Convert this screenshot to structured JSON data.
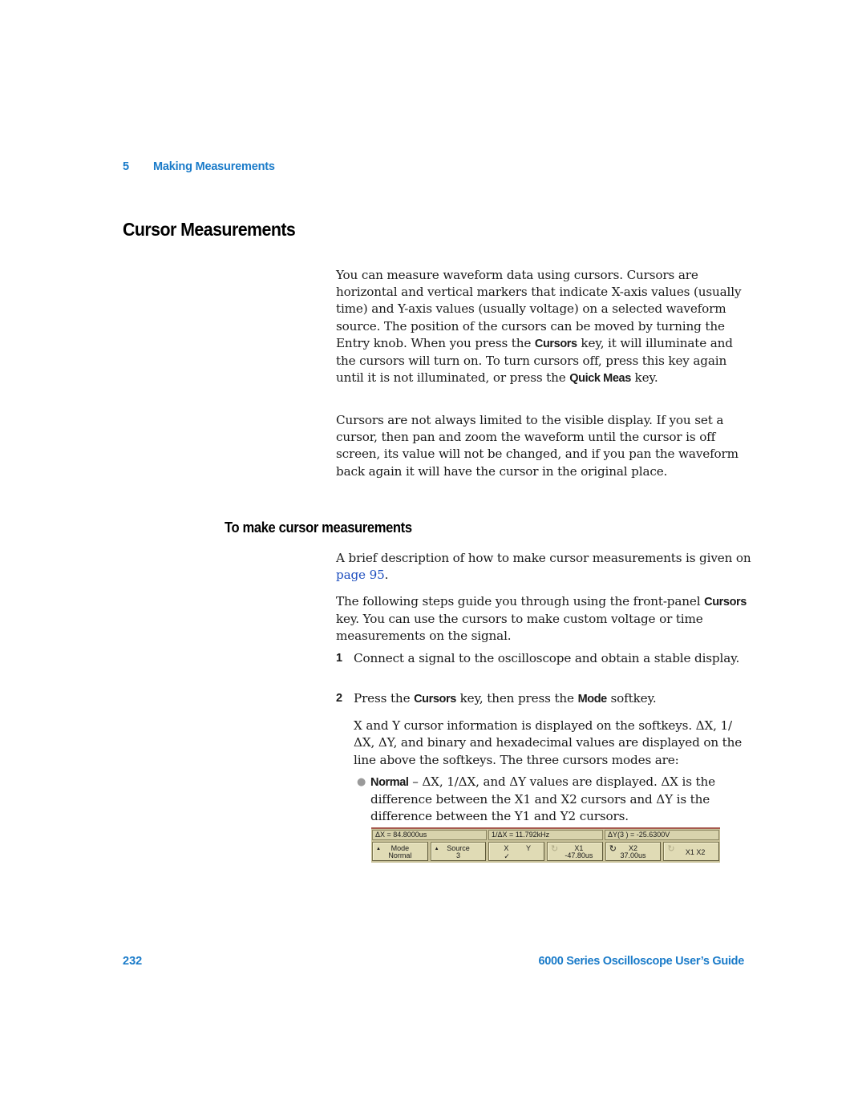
{
  "header": {
    "chapter_number": "5",
    "chapter_title": "Making Measurements"
  },
  "section": {
    "title": "Cursor Measurements",
    "intro": {
      "p1_a": "You can measure waveform data using cursors. Cursors are horizontal and vertical markers that indicate X-axis values (usually time) and Y-axis values (usually voltage) on a selected waveform source. The position of the cursors can be moved by turning the Entry knob. When you press the ",
      "p1_key1": "Cursors",
      "p1_b": " key, it will illuminate and the cursors will turn on. To turn cursors off, press this key again until it is not illuminated, or press the ",
      "p1_key2": "Quick Meas",
      "p1_c": " key.",
      "p2": "Cursors are not always limited to the visible display. If you set a cursor, then pan and zoom the waveform until the cursor is off screen, its value will not be changed, and if you pan the waveform back again it will have the cursor in the original place."
    }
  },
  "subsection": {
    "title": "To make cursor measurements",
    "p1_a": "A brief description of how to make cursor measurements is given on ",
    "p1_link": "page 95",
    "p1_b": ".",
    "p2_a": "The following steps guide you through using the front-panel ",
    "p2_key": "Cursors",
    "p2_b": " key. You can use the cursors to make custom voltage or time measurements on the signal.",
    "steps": [
      {
        "number": "1",
        "text": "Connect a signal to the oscilloscope and obtain a stable display."
      },
      {
        "number": "2",
        "text_a": "Press the ",
        "key1": "Cursors",
        "text_b": " key, then press the ",
        "key2": "Mode",
        "text_c": " softkey.",
        "detail": "X and Y cursor information is displayed on the softkeys.  ΔX, 1/ΔX, ΔY, and binary and hexadecimal values are displayed on the line above the softkeys. The three cursors modes are:"
      }
    ],
    "bullets": [
      {
        "label": "Normal",
        "text": " – ΔX, 1/ΔX, and ΔY values are displayed.  ΔX is the difference between the X1 and X2 cursors and ΔY is the difference between the Y1 and Y2 cursors."
      }
    ]
  },
  "scope_display": {
    "readouts": [
      "ΔX = 84.8000us",
      "1/ΔX = 11.792kHz",
      "ΔY(3 ) = -25.6300V"
    ],
    "softkeys": [
      {
        "line1": "Mode",
        "line2": "Normal",
        "icon": "up-triangle-icon"
      },
      {
        "line1": "Source",
        "line2": "3",
        "icon": "up-triangle-icon"
      },
      {
        "x_label": "X",
        "y_label": "Y",
        "selected_mark": "✓"
      },
      {
        "line1": "X1",
        "line2": "-47.80us",
        "icon": "entry-knob-icon",
        "active": false
      },
      {
        "line1": "X2",
        "line2": "37.00us",
        "icon": "entry-knob-icon",
        "active": true
      },
      {
        "label": "X1 X2",
        "icon": "entry-knob-icon",
        "active": false
      }
    ],
    "colors": {
      "background": "#c9c29a",
      "softkey": "#e0dbb5",
      "top_trace": "#a65a4e"
    }
  },
  "footer": {
    "page_number": "232",
    "guide_title": "6000 Series Oscilloscope User’s Guide"
  }
}
